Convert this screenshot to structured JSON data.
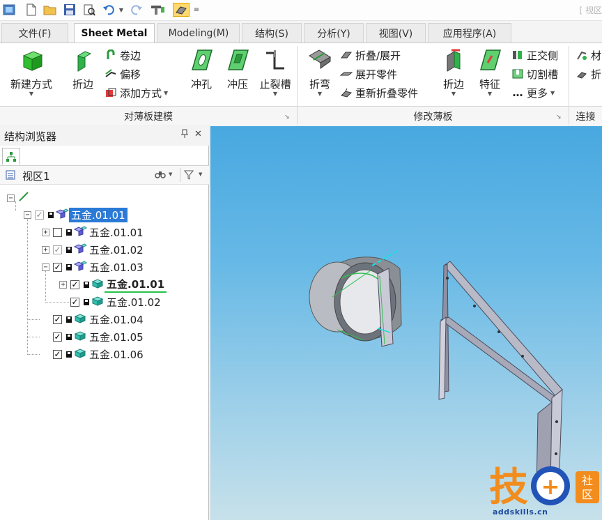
{
  "window": {
    "title_partial": "[ 视区"
  },
  "tabs": [
    {
      "label": "文件(F)",
      "active": false
    },
    {
      "label": "Sheet Metal",
      "active": true
    },
    {
      "label": "Modeling(M)",
      "active": false
    },
    {
      "label": "结构(S)",
      "active": false
    },
    {
      "label": "分析(Y)",
      "active": false
    },
    {
      "label": "视图(V)",
      "active": false
    },
    {
      "label": "应用程序(A)",
      "active": false
    }
  ],
  "ribbon": {
    "group1": {
      "label": "对薄板建模",
      "new_method": "新建方式",
      "flange": "折边",
      "curl": "卷边",
      "offset": "偏移",
      "add_method": "添加方式"
    },
    "group2": {
      "punch": "冲孔",
      "stamp": "冲压",
      "relief": "止裂槽"
    },
    "group3": {
      "label": "修改薄板",
      "bend": "折弯",
      "fold_unfold": "折叠/展开",
      "unfold_part": "展开零件",
      "refold_part": "重新折叠零件",
      "hem": "折边",
      "feature": "特征",
      "ortho": "正交侧",
      "cut_slot": "切割槽",
      "more": "更多"
    },
    "group4": {
      "label": "连接",
      "material": "材",
      "fold_more": "折"
    }
  },
  "structure_browser": {
    "title": "结构浏览器",
    "pin": "ᵖ",
    "close": "✕",
    "view_label": "视区1",
    "tree": [
      {
        "label": "五金.01.01",
        "checked": true,
        "selected": true
      },
      {
        "label": "五金.01.01",
        "checked": false
      },
      {
        "label": "五金.01.02",
        "checked": true,
        "grey": true
      },
      {
        "label": "五金.01.03",
        "checked": true
      },
      {
        "label": "五金.01.01",
        "checked": true,
        "bold": true
      },
      {
        "label": "五金.01.02",
        "checked": true
      },
      {
        "label": "五金.01.04",
        "checked": true
      },
      {
        "label": "五金.01.05",
        "checked": true
      },
      {
        "label": "五金.01.06",
        "checked": true
      }
    ]
  },
  "watermark": {
    "brand": "技",
    "plus": "+",
    "community": "社区",
    "url": "addskills.cn"
  },
  "colors": {
    "accent_blue": "#2a7ad6",
    "active_green": "#27c24a",
    "viewport_top": "#48a8e0",
    "viewport_bottom": "#c7e1ea",
    "watermark_orange": "#f28c1c",
    "watermark_blue": "#1f4aa0"
  }
}
